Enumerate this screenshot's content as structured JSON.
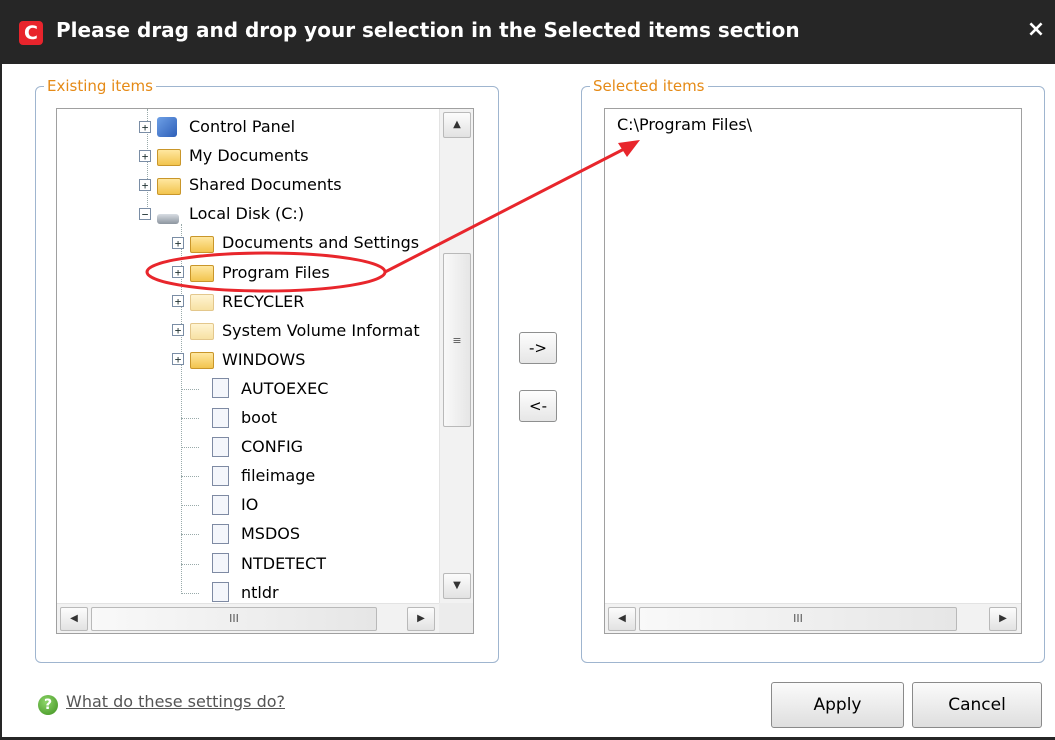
{
  "dialog": {
    "title": "Please drag and drop your selection in the Selected items section",
    "logo_letter": "C",
    "close_glyph": "×"
  },
  "existing": {
    "legend": "Existing items",
    "tree": [
      {
        "label": "Control Panel",
        "icon": "control-panel-icon",
        "expander": "+"
      },
      {
        "label": "My Documents",
        "icon": "folder-icon",
        "expander": "+"
      },
      {
        "label": "Shared Documents",
        "icon": "folder-icon",
        "expander": "+"
      },
      {
        "label": "Local Disk (C:)",
        "icon": "disk-icon",
        "expander": "−"
      },
      {
        "label": "Documents and Settings",
        "icon": "folder-icon",
        "expander": "+"
      },
      {
        "label": "Program Files",
        "icon": "folder-icon",
        "expander": "+"
      },
      {
        "label": "RECYCLER",
        "icon": "folder-icon",
        "expander": "+"
      },
      {
        "label": "System Volume Informat",
        "icon": "folder-icon",
        "expander": "+"
      },
      {
        "label": "WINDOWS",
        "icon": "folder-icon",
        "expander": "+"
      },
      {
        "label": "AUTOEXEC",
        "icon": "file-icon"
      },
      {
        "label": "boot",
        "icon": "file-icon"
      },
      {
        "label": "CONFIG",
        "icon": "file-icon"
      },
      {
        "label": "fileimage",
        "icon": "file-icon"
      },
      {
        "label": "IO",
        "icon": "file-icon"
      },
      {
        "label": "MSDOS",
        "icon": "file-icon"
      },
      {
        "label": "NTDETECT",
        "icon": "file-icon"
      },
      {
        "label": "ntldr",
        "icon": "file-icon"
      }
    ]
  },
  "selected": {
    "legend": "Selected items",
    "items": [
      "C:\\Program Files\\"
    ]
  },
  "buttons": {
    "add": "->",
    "remove": "<-",
    "apply": "Apply",
    "cancel": "Cancel"
  },
  "scroll": {
    "up": "▲",
    "down": "▼",
    "left": "◀",
    "right": "▶",
    "grip_h": "III",
    "grip_v": "≡"
  },
  "help": {
    "link": "What do these settings do?",
    "icon_glyph": "?"
  },
  "colors": {
    "titlebar": "#262626",
    "legend": "#e58a16",
    "group_border": "#9fb5cf",
    "annotation": "#e8262c"
  }
}
